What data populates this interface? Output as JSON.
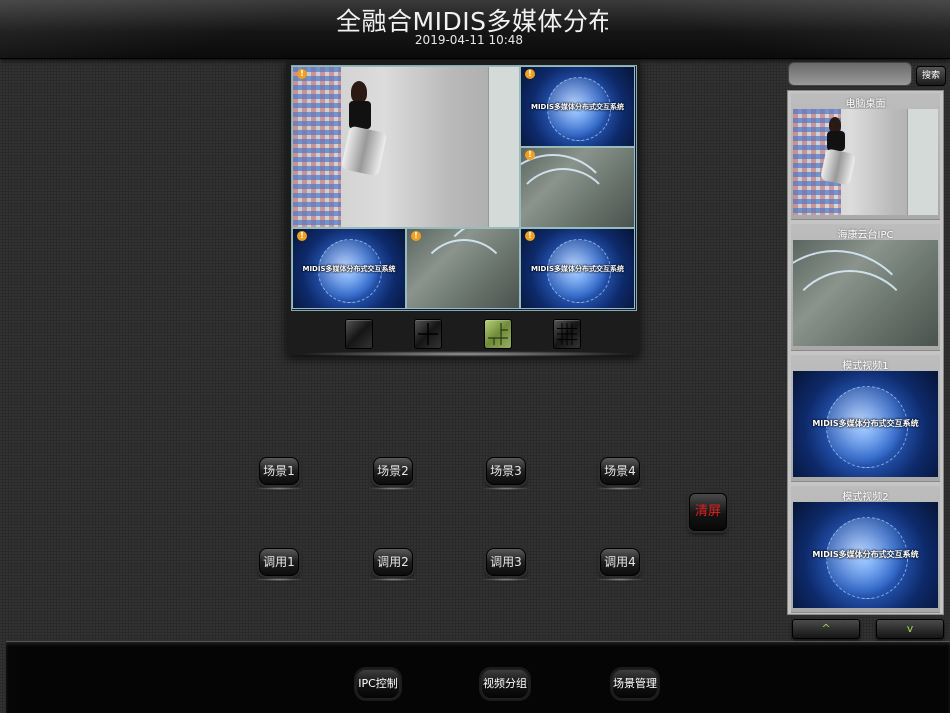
{
  "header": {
    "title": "全融合MIDIS多媒体分布式交互系统",
    "datetime": "2019-04-11 10:48"
  },
  "wall": {
    "cells": [
      {
        "type": "desktop"
      },
      {
        "type": "globe",
        "caption": "MIDIS多媒体分布式交互系统"
      },
      {
        "type": "ipc"
      },
      {
        "type": "globe",
        "caption": "MIDIS多媒体分布式交互系统"
      },
      {
        "type": "ipc"
      },
      {
        "type": "globe",
        "caption": "MIDIS多媒体分布式交互系统"
      }
    ],
    "layouts": [
      "1x1",
      "2x2",
      "3x3-custom",
      "4x4"
    ],
    "active_layout": "3x3-custom"
  },
  "scenes": {
    "scene_labels": [
      "场景1",
      "场景2",
      "场景3",
      "场景4"
    ],
    "recall_labels": [
      "调用1",
      "调用2",
      "调用3",
      "调用4"
    ],
    "clear_label": "清屏"
  },
  "sidebar": {
    "search_placeholder": "",
    "search_label": "搜索",
    "sources": [
      {
        "label": "电脑桌面",
        "type": "desktop"
      },
      {
        "label": "海康云台IPC",
        "type": "ipc"
      },
      {
        "label": "模式视频1",
        "type": "globe",
        "caption": "MIDIS多媒体分布式交互系统"
      },
      {
        "label": "模式视频2",
        "type": "globe",
        "caption": "MIDIS多媒体分布式交互系统"
      }
    ],
    "up_icon": "^",
    "down_icon": "v"
  },
  "footer": {
    "tabs": [
      "IPC控制",
      "视频分组",
      "场景管理"
    ]
  },
  "colors": {
    "accent_green": "#9cd25a",
    "clear_red": "#e02020",
    "badge_orange": "#f0a020"
  }
}
